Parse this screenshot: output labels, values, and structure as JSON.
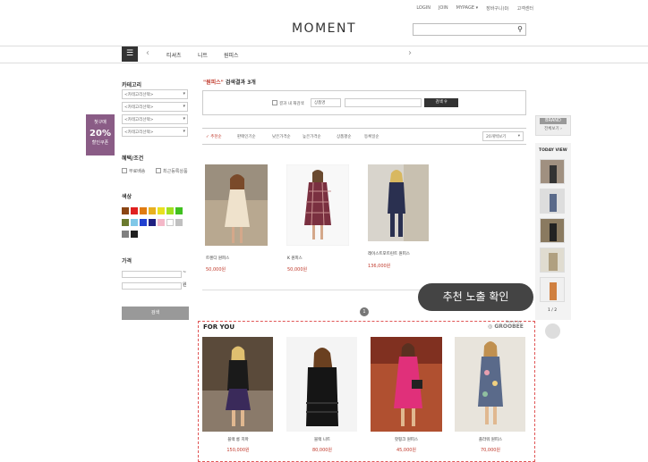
{
  "top_links": [
    "LOGIN",
    "JOIN",
    "MYPAGE ▾",
    "장바구니(0)",
    "고객센터"
  ],
  "logo": "MOMENT",
  "search": {
    "placeholder": "",
    "icon": "search-icon"
  },
  "nav": {
    "menu_icon": "menu-icon",
    "items": [
      "티셔츠",
      "니트",
      "원피스"
    ],
    "prev": "‹",
    "next": "›"
  },
  "sidebar": {
    "category_title": "카테고리",
    "category_selects": [
      "<카테고리선택>",
      "<카테고리선택>",
      "<카테고리선택>",
      "<카테고리선택>"
    ],
    "benefit_title": "혜택/조건",
    "benefit_options": [
      "무료배송",
      "최근등록상품"
    ],
    "color_title": "색상",
    "colors": [
      "#8b4513",
      "#e02020",
      "#e07b10",
      "#e8b020",
      "#e8e020",
      "#a0e020",
      "#40c020",
      "#6b7a2e",
      "#80c8e8",
      "#2040d0",
      "#202080",
      "#f4b8c8",
      "#ffffff",
      "#c0c0c0",
      "#808080",
      "#202020"
    ],
    "price_title": "가격",
    "price_from_suffix": "~",
    "price_to_suffix": "원",
    "search_button": "검색"
  },
  "coupon": {
    "line1": "첫구매",
    "line2": "20%",
    "line3": "할인쿠폰"
  },
  "results": {
    "keyword": "\"원피스\"",
    "suffix": " 검색결과 3개"
  },
  "filter": {
    "in_result_label": "결과 내 재검색",
    "select_value": "상품명",
    "button": "검색"
  },
  "sort": {
    "options": [
      "추천순",
      "판매인기순",
      "낮은가격순",
      "높은가격순",
      "상품평순",
      "등록일순"
    ],
    "active": "추천순",
    "per_page": "20개씩보기"
  },
  "products": [
    {
      "name": "트렌디 원피스",
      "price": "50,000원"
    },
    {
      "name": "K 원피스",
      "price": "50,000원"
    },
    {
      "name": "레이스트포트린트 원피스",
      "price": "136,000원"
    }
  ],
  "page_number": "1",
  "recommend": {
    "title": "FOR YOU",
    "brand": "GROOBEE",
    "brand_small": "Search by",
    "items": [
      {
        "name": "블랙 롱 치마",
        "price": "150,000원"
      },
      {
        "name": "블랙 니트",
        "price": "80,000원"
      },
      {
        "name": "핫핑크 원피스",
        "price": "45,000원"
      },
      {
        "name": "플라워 원피스",
        "price": "70,000원"
      }
    ]
  },
  "tooltip": "추천 노출 확인",
  "brand_box": {
    "label": "BRAND",
    "link": "전체보기 ›"
  },
  "today_view": {
    "title": "TODAY VIEW",
    "page": "1 / 2"
  }
}
